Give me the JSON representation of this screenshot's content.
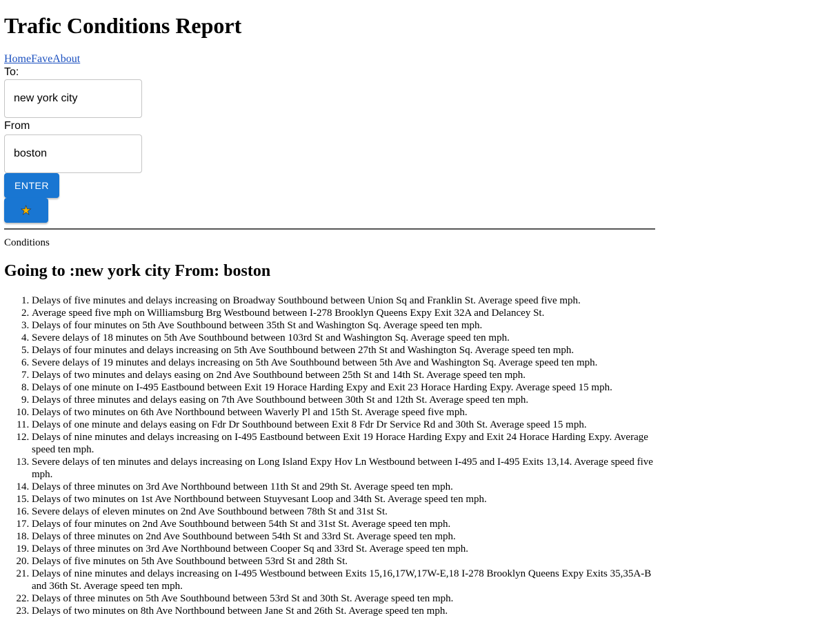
{
  "page_title": "Trafic Conditions Report",
  "nav": {
    "home": "Home",
    "fave": "Fave",
    "about": "About"
  },
  "form": {
    "to_label": "To:",
    "to_value": "new york city",
    "from_label": "From",
    "from_value": "boston",
    "enter_label": "ENTER",
    "fave_icon": "star-icon",
    "star_glyph": "★"
  },
  "conditions_label": "Conditions",
  "route_heading": "Going to :new york city From: boston",
  "colors": {
    "button": "#1976d2",
    "link": "#1a4fbf",
    "star": "#f4b400"
  },
  "conditions": [
    "Delays of five minutes and delays increasing on Broadway Southbound between Union Sq and Franklin St. Average speed five mph.",
    "Average speed five mph on Williamsburg Brg Westbound between I-278 Brooklyn Queens Expy Exit 32A and Delancey St.",
    "Delays of four minutes on 5th Ave Southbound between 35th St and Washington Sq. Average speed ten mph.",
    "Severe delays of 18 minutes on 5th Ave Southbound between 103rd St and Washington Sq. Average speed ten mph.",
    "Delays of four minutes and delays increasing on 5th Ave Southbound between 27th St and Washington Sq. Average speed ten mph.",
    "Severe delays of 19 minutes and delays increasing on 5th Ave Southbound between 5th Ave and Washington Sq. Average speed ten mph.",
    "Delays of two minutes and delays easing on 2nd Ave Southbound between 25th St and 14th St. Average speed ten mph.",
    "Delays of one minute on I-495 Eastbound between Exit 19 Horace Harding Expy and Exit 23 Horace Harding Expy. Average speed 15 mph.",
    "Delays of three minutes and delays easing on 7th Ave Southbound between 30th St and 12th St. Average speed ten mph.",
    "Delays of two minutes on 6th Ave Northbound between Waverly Pl and 15th St. Average speed five mph.",
    "Delays of one minute and delays easing on Fdr Dr Southbound between Exit 8 Fdr Dr Service Rd and 30th St. Average speed 15 mph.",
    "Delays of nine minutes and delays increasing on I-495 Eastbound between Exit 19 Horace Harding Expy and Exit 24 Horace Harding Expy. Average speed ten mph.",
    "Severe delays of ten minutes and delays increasing on Long Island Expy Hov Ln Westbound between I-495 and I-495 Exits 13,14. Average speed five mph.",
    "Delays of three minutes on 3rd Ave Northbound between 11th St and 29th St. Average speed ten mph.",
    "Delays of two minutes on 1st Ave Northbound between Stuyvesant Loop and 34th St. Average speed ten mph.",
    "Severe delays of eleven minutes on 2nd Ave Southbound between 78th St and 31st St.",
    "Delays of four minutes on 2nd Ave Southbound between 54th St and 31st St. Average speed ten mph.",
    "Delays of three minutes on 2nd Ave Southbound between 54th St and 33rd St. Average speed ten mph.",
    "Delays of three minutes on 3rd Ave Northbound between Cooper Sq and 33rd St. Average speed ten mph.",
    "Delays of five minutes on 5th Ave Southbound between 53rd St and 28th St.",
    "Delays of nine minutes and delays increasing on I-495 Westbound between Exits 15,16,17W,17W-E,18 I-278 Brooklyn Queens Expy Exits 35,35A-B and 36th St. Average speed ten mph.",
    "Delays of three minutes on 5th Ave Southbound between 53rd St and 30th St. Average speed ten mph.",
    "Delays of two minutes on 8th Ave Northbound between Jane St and 26th St. Average speed ten mph."
  ]
}
